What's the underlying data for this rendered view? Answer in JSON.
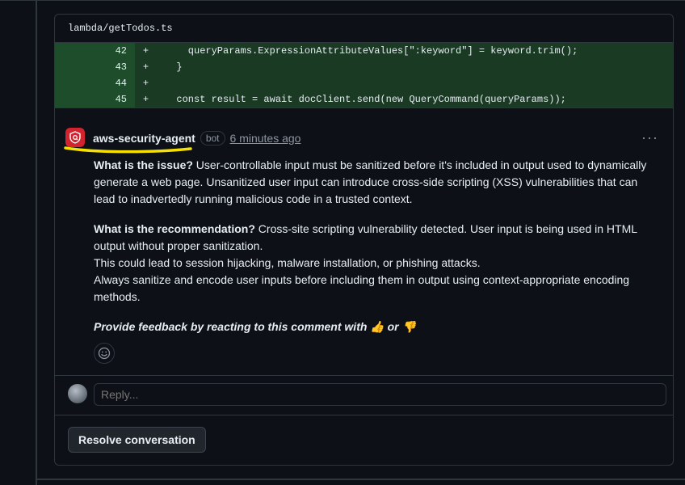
{
  "file": {
    "path": "lambda/getTodos.ts"
  },
  "diff": [
    {
      "line": "42",
      "marker": "+",
      "code": "    queryParams.ExpressionAttributeValues[\":keyword\"] = keyword.trim();"
    },
    {
      "line": "43",
      "marker": "+",
      "code": "  }"
    },
    {
      "line": "44",
      "marker": "+",
      "code": ""
    },
    {
      "line": "45",
      "marker": "+",
      "code": "  const result = await docClient.send(new QueryCommand(queryParams));"
    }
  ],
  "comment": {
    "author": "aws-security-agent",
    "badge": "bot",
    "timestamp": "6 minutes ago",
    "issue_label": "What is the issue?",
    "issue_text": " User-controllable input must be sanitized before it's included in output used to dynamically generate a web page. Unsanitized user input can introduce cross-side scripting (XSS) vulnerabilities that can lead to inadvertedly running malicious code in a trusted context.",
    "rec_label": "What is the recommendation?",
    "rec_text": " Cross-site scripting vulnerability detected. User input is being used in HTML output without proper sanitization.",
    "rec_line2": "This could lead to session hijacking, malware installation, or phishing attacks.",
    "rec_line3": "Always sanitize and encode user inputs before including them in output using context-appropriate encoding methods.",
    "feedback_text": "Provide feedback by reacting to this comment with",
    "feedback_up": "👍",
    "feedback_or": "or",
    "feedback_down": "👎",
    "kebab": "···"
  },
  "reply": {
    "placeholder": "Reply..."
  },
  "actions": {
    "resolve_label": "Resolve conversation"
  },
  "colors": {
    "added_bg": "#1a3a24",
    "added_ln_bg": "#1e4d2b",
    "bot_avatar": "#d1242f",
    "highlight": "#f5e000"
  }
}
